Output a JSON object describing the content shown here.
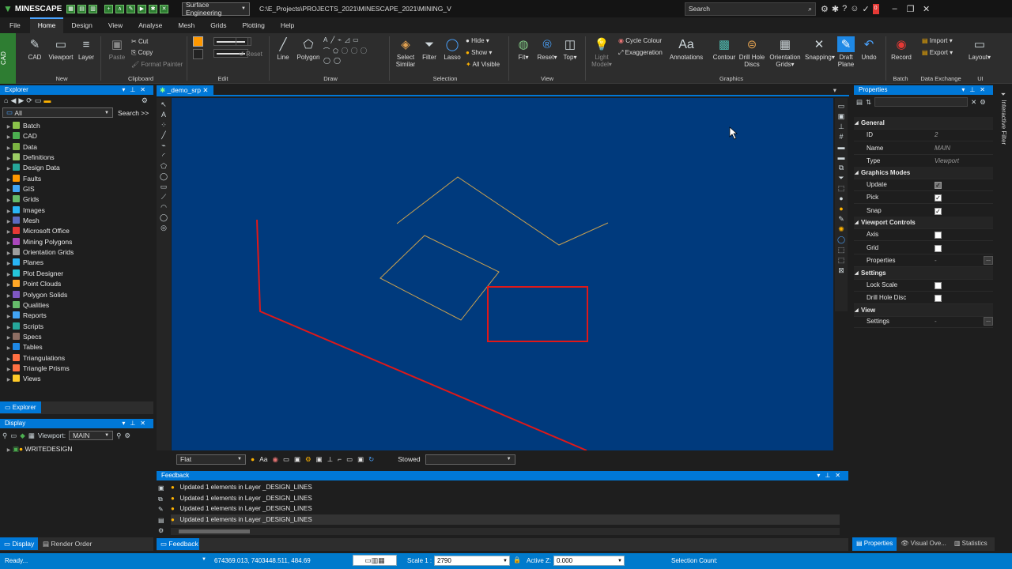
{
  "app": {
    "name": "MINESCAPE",
    "workspace": "Surface Engineering",
    "path": "C:\\E_Projects\\PROJECTS_2021\\MINESCAPE_2021\\MINING_V",
    "search_placeholder": "Search",
    "notification_count": "0"
  },
  "menu": [
    "File",
    "Home",
    "Design",
    "View",
    "Analyse",
    "Mesh",
    "Grids",
    "Plotting",
    "Help"
  ],
  "ribbon": {
    "side_tab": "CAD",
    "new": {
      "cad": "CAD",
      "viewport": "Viewport",
      "layer": "Layer"
    },
    "clipboard": {
      "paste": "Paste",
      "cut": "Cut",
      "copy": "Copy",
      "format_painter": "Format Painter"
    },
    "edit": {
      "reset": "Reset"
    },
    "draw": {
      "line": "Line",
      "polygon": "Polygon"
    },
    "selection": {
      "select_similar": "Select Similar",
      "filter": "Filter",
      "lasso": "Lasso",
      "hide": "Hide",
      "show": "Show",
      "all_visible": "All Visible"
    },
    "view": {
      "fit": "Fit",
      "reset": "Reset",
      "top": "Top"
    },
    "graphics": {
      "light_model": "Light Model",
      "cycle_colour": "Cycle Colour",
      "exaggeration": "Exaggeration",
      "annotations": "Annotations",
      "contour": "Contour",
      "drill_hole_discs": "Drill Hole Discs",
      "orientation_grids": "Orientation Grids",
      "snapping": "Snapping",
      "draft_plane": "Draft Plane",
      "undo": "Undo"
    },
    "batch": {
      "record": "Record"
    },
    "data_exchange": {
      "import": "Import",
      "export": "Export"
    },
    "ui": {
      "layout": "Layout"
    },
    "groups": [
      "New",
      "Clipboard",
      "Edit",
      "Draw",
      "Selection",
      "View",
      "Graphics",
      "Batch",
      "Data Exchange",
      "UI"
    ]
  },
  "explorer": {
    "title": "Explorer",
    "filter": "All",
    "search": "Search >>",
    "items": [
      "Batch",
      "CAD",
      "Data",
      "Definitions",
      "Design Data",
      "Faults",
      "GIS",
      "Grids",
      "Images",
      "Mesh",
      "Microsoft Office",
      "Mining Polygons",
      "Orientation Grids",
      "Planes",
      "Plot Designer",
      "Point Clouds",
      "Polygon Solids",
      "Qualities",
      "Reports",
      "Scripts",
      "Specs",
      "Tables",
      "Triangulations",
      "Triangle Prisms",
      "Views"
    ],
    "item_colors": [
      "#8bc34a",
      "#4caf50",
      "#7cb342",
      "#9ccc65",
      "#26a69a",
      "#ff9800",
      "#42a5f5",
      "#66bb6a",
      "#29b6f6",
      "#5c6bc0",
      "#e53935",
      "#ab47bc",
      "#9e9e9e",
      "#29b6f6",
      "#26c6da",
      "#ffa726",
      "#7e57c2",
      "#66bb6a",
      "#42a5f5",
      "#26a69a",
      "#8d6e63",
      "#1e88e5",
      "#ff7043",
      "#ff7043",
      "#ffca28"
    ],
    "tab": "Explorer"
  },
  "display": {
    "title": "Display",
    "viewport_label": "Viewport:",
    "viewport_value": "MAIN",
    "layer": "WRITEDESIGN",
    "tab_display": "Display",
    "tab_render": "Render Order"
  },
  "document": {
    "tab": "_demo_srp",
    "bg": "#003a7d"
  },
  "viewport_toolbar": {
    "mode": "Flat",
    "stowed": "Stowed"
  },
  "properties": {
    "title": "Properties",
    "general": "General",
    "id_label": "ID",
    "id_value": "2",
    "name_label": "Name",
    "name_value": "MAIN",
    "type_label": "Type",
    "type_value": "Viewport",
    "graphics_modes": "Graphics Modes",
    "update": "Update",
    "pick": "Pick",
    "snap": "Snap",
    "viewport_controls": "Viewport Controls",
    "axis": "Axis",
    "grid": "Grid",
    "props": "Properties",
    "dash": "-",
    "settings_cat": "Settings",
    "lock_scale": "Lock Scale",
    "drill_hole_disc": "Drill Hole Disc",
    "view_cat": "View",
    "view_settings": "Settings",
    "tabs": [
      "Properties",
      "Visual Ove...",
      "Statistics"
    ],
    "side_tab": "Interactive Filter"
  },
  "feedback": {
    "title": "Feedback",
    "tab": "Feedback",
    "rows": [
      "Updated 1 elements in Layer _DESIGN_LINES",
      "Updated 1 elements in Layer _DESIGN_LINES",
      "Updated 1 elements in Layer _DESIGN_LINES",
      "Updated 1 elements in Layer _DESIGN_LINES"
    ]
  },
  "status": {
    "ready": "Ready...",
    "coords": "674369.013, 7403448.511, 484.69",
    "scale_label": "Scale 1 :",
    "scale": "2790",
    "active_z_label": "Active Z:",
    "active_z": "0.000",
    "selection_count": "Selection Count:"
  }
}
